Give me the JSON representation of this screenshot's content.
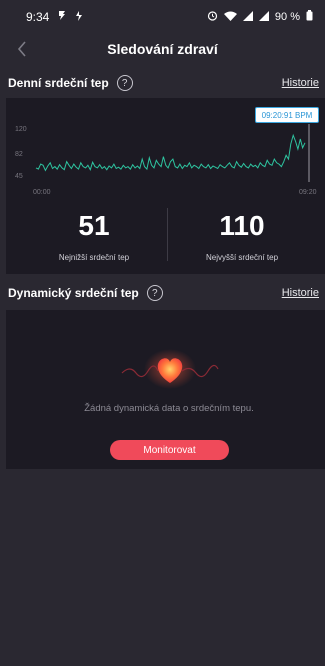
{
  "status_bar": {
    "time": "9:34",
    "battery": "90 %"
  },
  "header": {
    "title": "Sledování zdraví"
  },
  "daily": {
    "title": "Denní srdeční tep",
    "history_label": "Historie",
    "tooltip": "09:20:91 BPM",
    "chart_data": {
      "type": "line",
      "y_ticks": [
        "120",
        "82",
        "45"
      ],
      "x_ticks": [
        "00:00",
        "09:20"
      ],
      "ylim": [
        45,
        120
      ],
      "color": "#2ec4a0",
      "series": [
        {
          "values": [
            58,
            56,
            64,
            62,
            54,
            61,
            66,
            57,
            60,
            56,
            63,
            58,
            55,
            68,
            62,
            57,
            64,
            59,
            56,
            66,
            60,
            58,
            62,
            55,
            67,
            60,
            58,
            63,
            57,
            60,
            55,
            61,
            58,
            64,
            57,
            59,
            56,
            62,
            58,
            60,
            56,
            63,
            58,
            61,
            57,
            72,
            60,
            56,
            74,
            62,
            58,
            70,
            64,
            60,
            76,
            62,
            58,
            68,
            72,
            60,
            58,
            64,
            57,
            62,
            60,
            66,
            58,
            62,
            60,
            57,
            64,
            60,
            58,
            63,
            57,
            61,
            59,
            57,
            63,
            60,
            58,
            62,
            66,
            60,
            58,
            68,
            62,
            59,
            65,
            60,
            58,
            64,
            60,
            62,
            58,
            66,
            62,
            60,
            70,
            64,
            62,
            72,
            66,
            64,
            60,
            68,
            78,
            72,
            96,
            110,
            100,
            88,
            104,
            90,
            98
          ]
        }
      ]
    },
    "min_value": "51",
    "min_label": "Nejnižší srdeční tep",
    "max_value": "110",
    "max_label": "Nejvyšší srdeční tep"
  },
  "dynamic": {
    "title": "Dynamický srdeční tep",
    "history_label": "Historie",
    "empty_text": "Žádná dynamická data o srdečním tepu.",
    "monitor_label": "Monitorovat"
  }
}
